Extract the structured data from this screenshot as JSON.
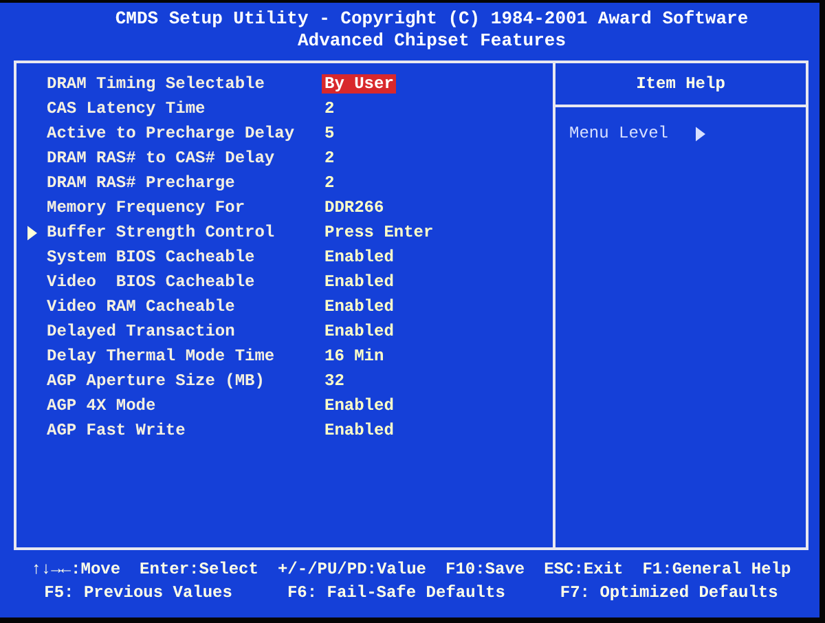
{
  "title": "CMDS Setup Utility - Copyright (C) 1984-2001 Award Software",
  "subtitle": "Advanced Chipset Features",
  "settings": [
    {
      "label": "DRAM Timing Selectable",
      "value": "By User",
      "selected": true,
      "kind": "option"
    },
    {
      "label": "CAS Latency Time",
      "value": "2",
      "selected": false,
      "kind": "option"
    },
    {
      "label": "Active to Precharge Delay",
      "value": "5",
      "selected": false,
      "kind": "option"
    },
    {
      "label": "DRAM RAS# to CAS# Delay",
      "value": "2",
      "selected": false,
      "kind": "option"
    },
    {
      "label": "DRAM RAS# Precharge",
      "value": "2",
      "selected": false,
      "kind": "option"
    },
    {
      "label": "Memory Frequency For",
      "value": "DDR266",
      "selected": false,
      "kind": "option"
    },
    {
      "label": "Buffer Strength Control",
      "value": "Press Enter",
      "selected": false,
      "kind": "submenu"
    },
    {
      "label": "System BIOS Cacheable",
      "value": "Enabled",
      "selected": false,
      "kind": "option"
    },
    {
      "label": "Video  BIOS Cacheable",
      "value": "Enabled",
      "selected": false,
      "kind": "option"
    },
    {
      "label": "Video RAM Cacheable",
      "value": "Enabled",
      "selected": false,
      "kind": "option"
    },
    {
      "label": "Delayed Transaction",
      "value": "Enabled",
      "selected": false,
      "kind": "option"
    },
    {
      "label": "Delay Thermal Mode Time",
      "value": "16 Min",
      "selected": false,
      "kind": "option"
    },
    {
      "label": "AGP Aperture Size (MB)",
      "value": "32",
      "selected": false,
      "kind": "option"
    },
    {
      "label": "AGP 4X Mode",
      "value": "Enabled",
      "selected": false,
      "kind": "option"
    },
    {
      "label": "AGP Fast Write",
      "value": "Enabled",
      "selected": false,
      "kind": "option"
    }
  ],
  "item_help": {
    "title": "Item Help",
    "menu_level": "Menu Level"
  },
  "footer": [
    [
      "↑↓→←:Move",
      "Enter:Select",
      "+/-/PU/PD:Value",
      "F10:Save",
      "ESC:Exit",
      "F1:General Help"
    ],
    [
      "F5: Previous Values",
      "F6: Fail-Safe Defaults",
      "F7: Optimized Defaults"
    ]
  ]
}
